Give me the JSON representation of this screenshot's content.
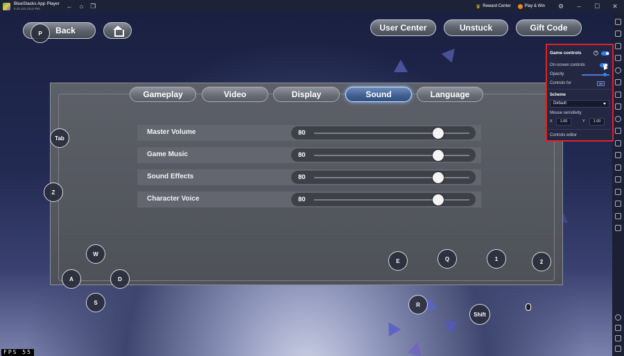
{
  "window": {
    "title": "BlueStacks App Player",
    "subtitle": "5.20.110.1014  P64",
    "reward_center": "Reward Center",
    "play_win": "Play & Win"
  },
  "top_buttons": {
    "back": "Back",
    "user_center": "User Center",
    "unstuck": "Unstuck",
    "gift_code": "Gift Code"
  },
  "tabs": [
    {
      "label": "Gameplay",
      "active": false
    },
    {
      "label": "Video",
      "active": false
    },
    {
      "label": "Display",
      "active": false
    },
    {
      "label": "Sound",
      "active": true
    },
    {
      "label": "Language",
      "active": false
    }
  ],
  "settings": [
    {
      "label": "Master Volume",
      "value": 80
    },
    {
      "label": "Game Music",
      "value": 80
    },
    {
      "label": "Sound Effects",
      "value": 80
    },
    {
      "label": "Character Voice",
      "value": 80
    }
  ],
  "keys": {
    "p": "P",
    "tab": "Tab",
    "z": "Z",
    "w": "W",
    "a": "A",
    "d": "D",
    "s": "S",
    "e": "E",
    "q": "Q",
    "one": "1",
    "two": "2",
    "r": "R",
    "shift": "Shift"
  },
  "game_controls": {
    "title": "Game controls",
    "on_screen_controls": "On-screen controls",
    "opacity": "Opacity",
    "controls_for": "Controls for",
    "scheme_label": "Scheme",
    "scheme_value": "Default",
    "mouse_sensitivity": "Mouse sensitivity",
    "x_label": "X",
    "x_value": "1.00",
    "y_label": "Y",
    "y_value": "1.00",
    "controls_editor": "Controls editor",
    "help": "?",
    "kbd": "⌨"
  },
  "fps": {
    "label": "FPS",
    "value": "55"
  },
  "colors": {
    "accent": "#2f7cf2",
    "highlight_border": "#e0222c",
    "active_tab": "#3f5f92"
  }
}
